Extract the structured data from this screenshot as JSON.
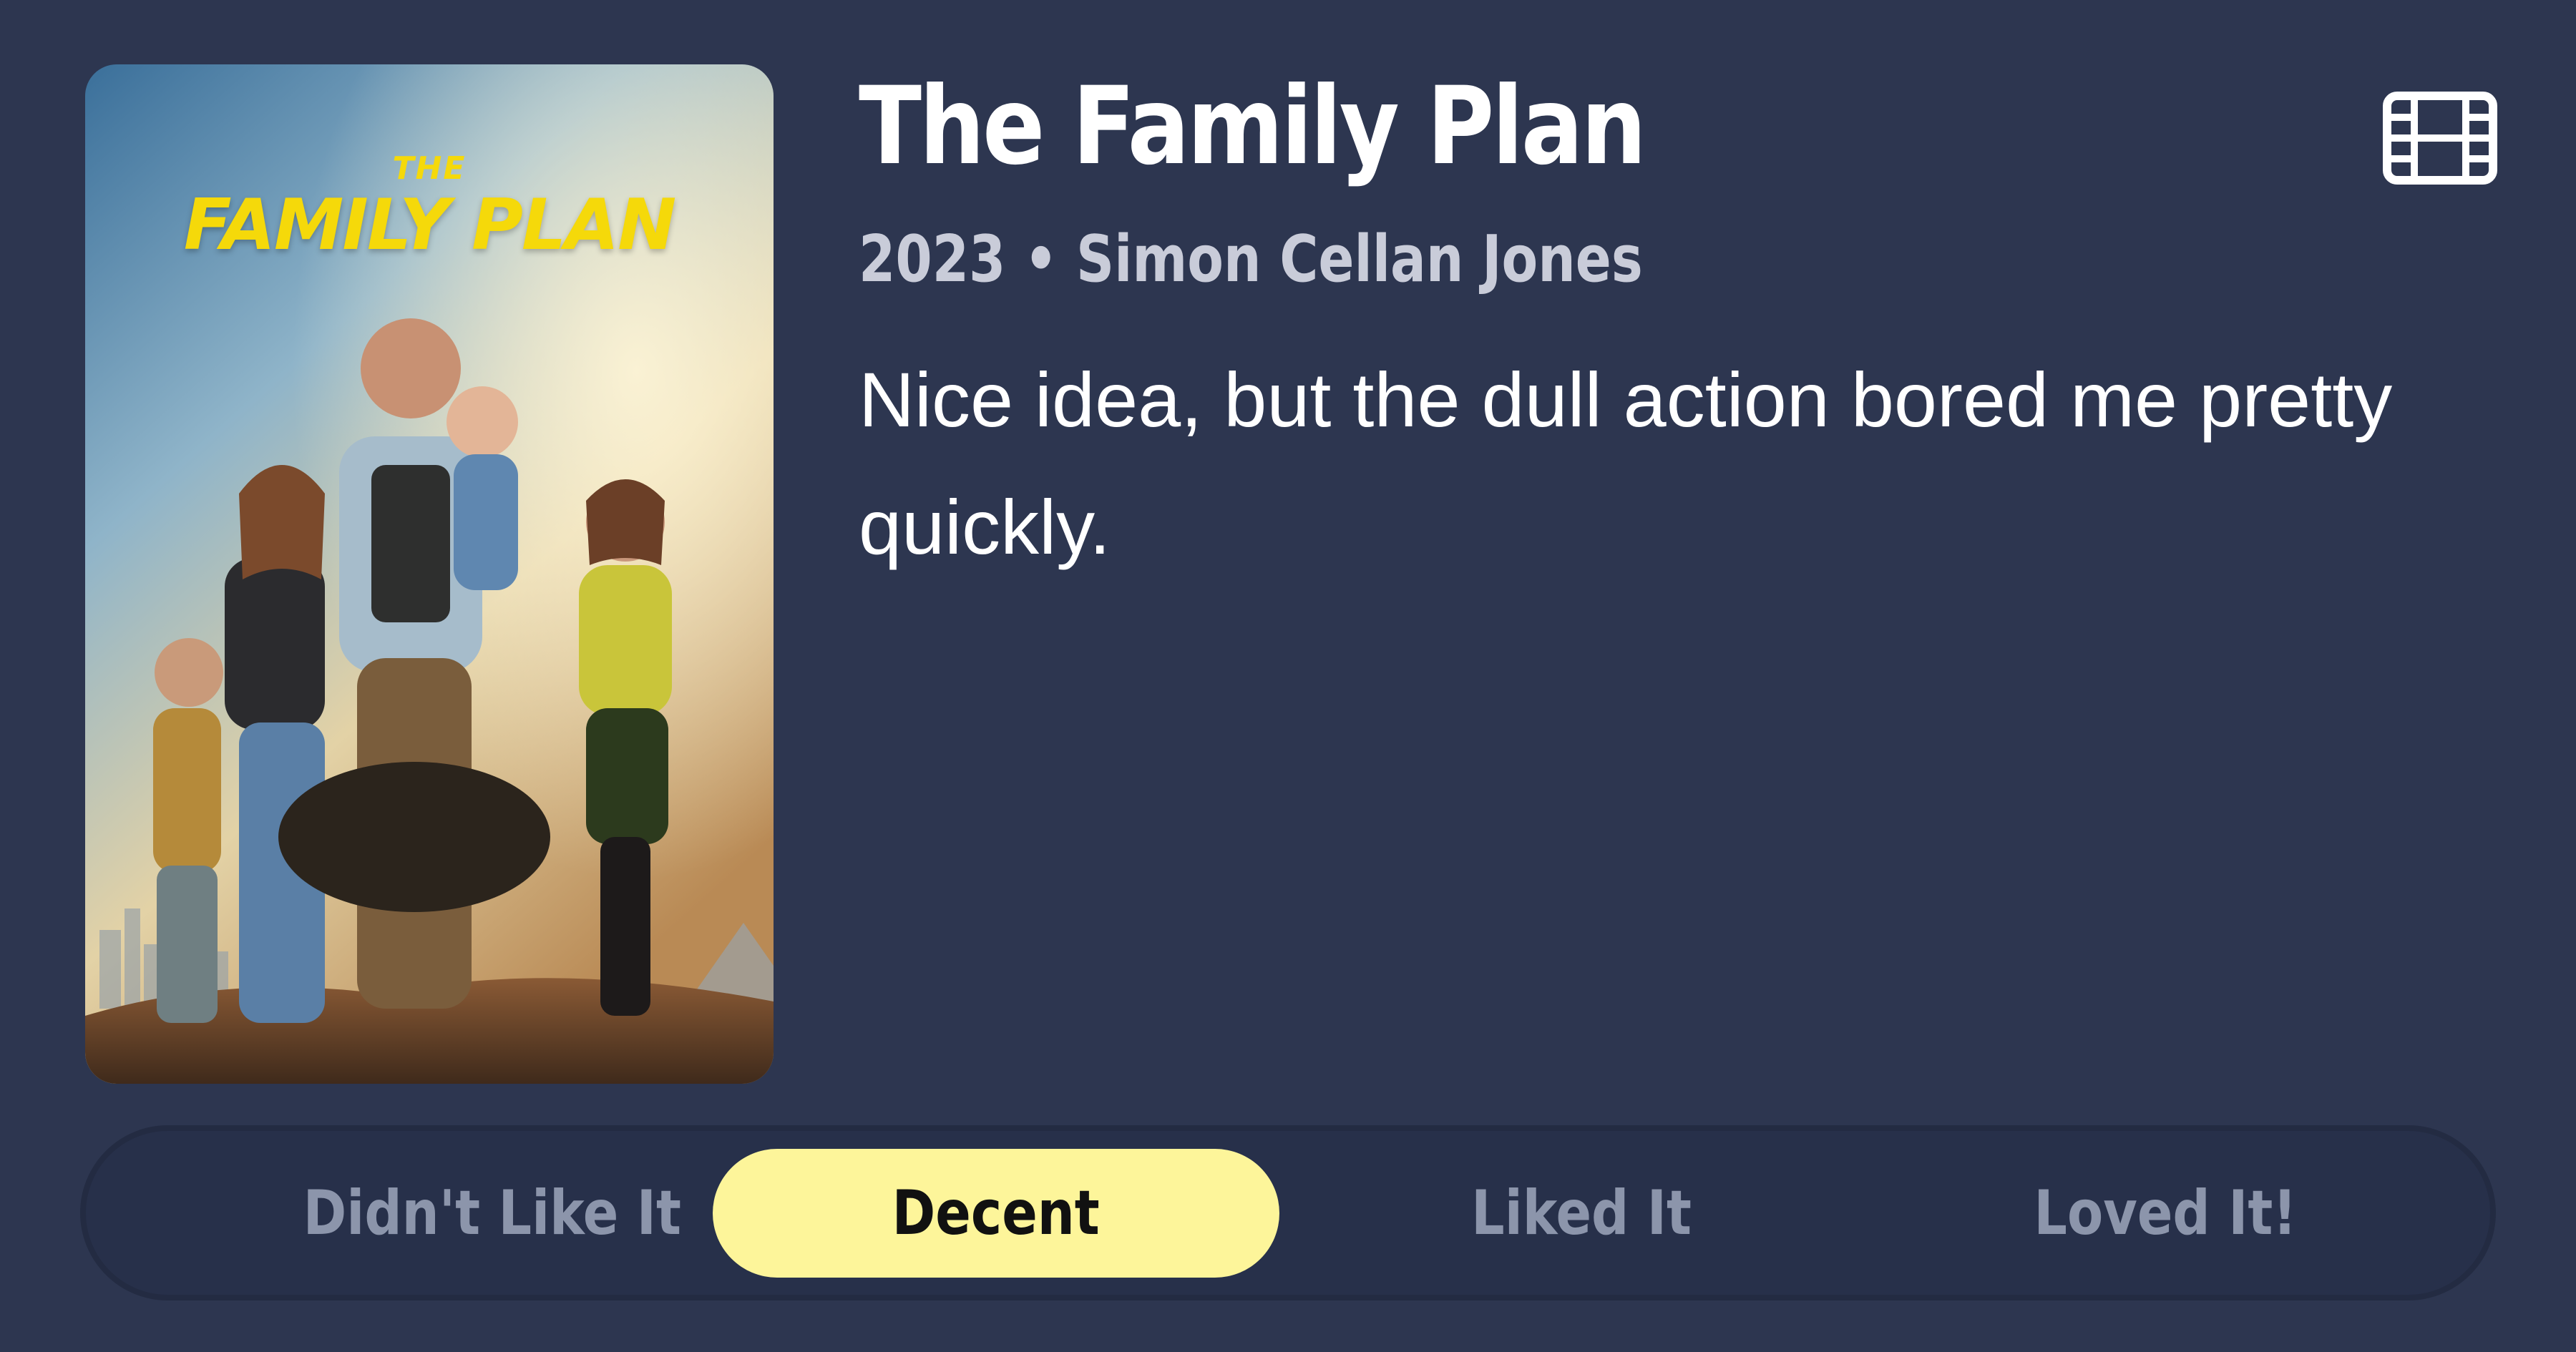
{
  "movie": {
    "title": "The Family Plan",
    "meta": "2023 • Simon Cellan Jones",
    "review": "Nice idea, but the dull action bored me pretty quickly.",
    "poster": {
      "title_small": "THE",
      "title_big": "FAMILY PLAN"
    }
  },
  "icons": {
    "media_type": "film-icon"
  },
  "rating": {
    "options": [
      "Didn't Like It",
      "Decent",
      "Liked It",
      "Loved It!"
    ],
    "selected": "Decent"
  },
  "colors": {
    "background": "#2d3650",
    "selected_pill": "#fdf59a",
    "unselected_text": "#8c95ab",
    "title_text": "#ffffff",
    "meta_text": "#c9ccd9",
    "poster_title": "#f5d90a"
  }
}
